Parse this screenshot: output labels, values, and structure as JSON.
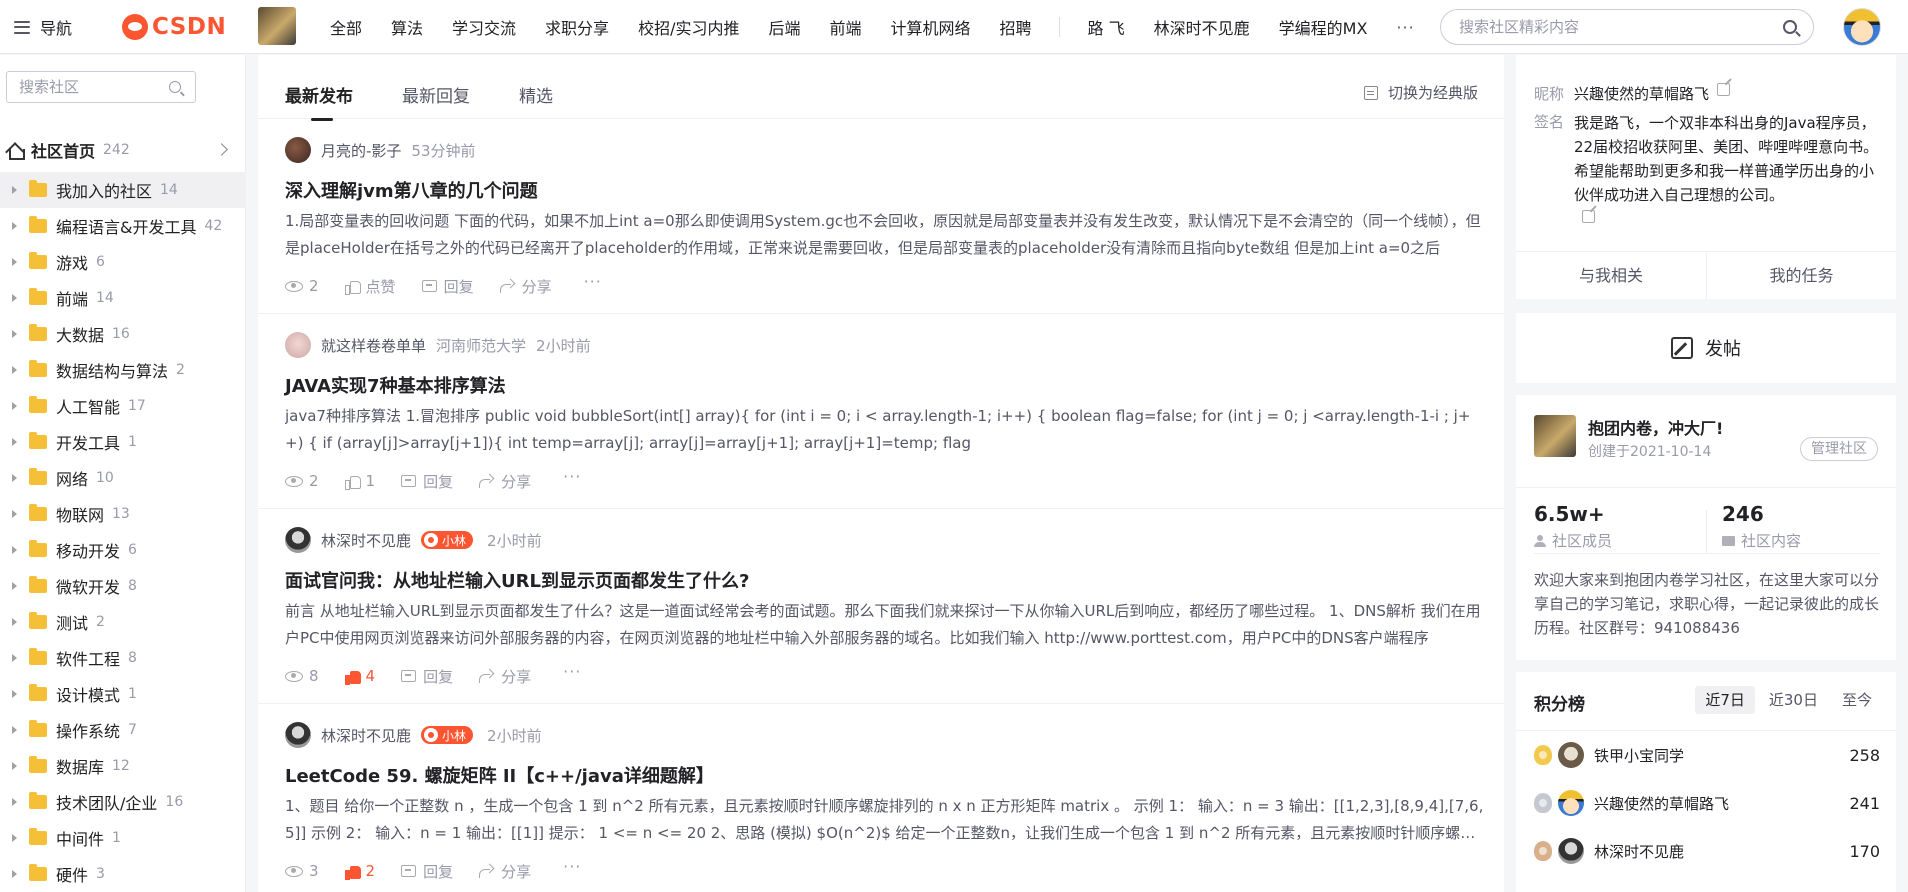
{
  "header": {
    "nav_label": "导航",
    "logo_text": "CSDN",
    "nav_items": [
      "全部",
      "算法",
      "学习交流",
      "求职分享",
      "校招/实习内推",
      "后端",
      "前端",
      "计算机网络",
      "招聘"
    ],
    "extra_items": [
      "路 飞",
      "林深时不见鹿",
      "学编程的MX"
    ],
    "more": "···",
    "search_placeholder": "搜索社区精彩内容",
    "colors": {
      "brand": "#fc5531"
    }
  },
  "sidebar": {
    "search_placeholder": "搜索社区",
    "home": {
      "label": "社区首页",
      "count": "242"
    },
    "categories": [
      {
        "label": "我加入的社区",
        "count": "14"
      },
      {
        "label": "编程语言&开发工具",
        "count": "42"
      },
      {
        "label": "游戏",
        "count": "6"
      },
      {
        "label": "前端",
        "count": "14"
      },
      {
        "label": "大数据",
        "count": "16"
      },
      {
        "label": "数据结构与算法",
        "count": "2"
      },
      {
        "label": "人工智能",
        "count": "17"
      },
      {
        "label": "开发工具",
        "count": "1"
      },
      {
        "label": "网络",
        "count": "10"
      },
      {
        "label": "物联网",
        "count": "13"
      },
      {
        "label": "移动开发",
        "count": "6"
      },
      {
        "label": "微软开发",
        "count": "8"
      },
      {
        "label": "测试",
        "count": "2"
      },
      {
        "label": "软件工程",
        "count": "8"
      },
      {
        "label": "设计模式",
        "count": "1"
      },
      {
        "label": "操作系统",
        "count": "7"
      },
      {
        "label": "数据库",
        "count": "12"
      },
      {
        "label": "技术团队/企业",
        "count": "16"
      },
      {
        "label": "中间件",
        "count": "1"
      },
      {
        "label": "硬件",
        "count": "3"
      }
    ]
  },
  "feed": {
    "tabs": [
      "最新发布",
      "最新回复",
      "精选"
    ],
    "switch_label": "切换为经典版",
    "action_labels": {
      "like": "点赞",
      "reply": "回复",
      "share": "分享",
      "more": "···"
    },
    "posts": [
      {
        "author": "月亮的-影子",
        "school": "",
        "badge": "",
        "time": "53分钟前",
        "title": "深入理解jvm第八章的几个问题",
        "excerpt": "1.局部变量表的回收问题 下面的代码，如果不加上int a=0那么即使调用System.gc也不会回收，原因就是局部变量表并没有发生改变，默认情况下是不会清空的（同一个线帧），但是placeHolder在括号之外的代码已经离开了placeholder的作用域，正常来说是需要回收，但是局部变量表的placeholder没有清除而且指向byte数组 但是加上int a=0之后",
        "views": "2",
        "likes": "点赞",
        "liked": false
      },
      {
        "author": "就这样卷卷单单",
        "school": "河南师范大学",
        "badge": "",
        "time": "2小时前",
        "title": "JAVA实现7种基本排序算法",
        "excerpt": "java7种排序算法 1.冒泡排序 public void bubbleSort(int[] array){ for (int i = 0; i < array.length-1; i++) { boolean flag=false; for (int j = 0; j <array.length-1-i ; j++) { if (array[j]>array[j+1]){ int temp=array[j]; array[j]=array[j+1]; array[j+1]=temp; flag",
        "views": "2",
        "likes": "1",
        "liked": false
      },
      {
        "author": "林深时不见鹿",
        "school": "",
        "badge": "小林",
        "time": "2小时前",
        "title": "面试官问我：从地址栏输入URL到显示页面都发生了什么?",
        "excerpt": "前言 从地址栏输入URL到显示页面都发生了什么？这是一道面试经常会考的面试题。那么下面我们就来探讨一下从你输入URL后到响应，都经历了哪些过程。 1、DNS解析 我们在用户PC中使用网页浏览器来访问外部服务器的内容，在网页浏览器的地址栏中输入外部服务器的域名。比如我们输入 http://www.porttest.com，用户PC中的DNS客户端程序",
        "views": "8",
        "likes": "4",
        "liked": true
      },
      {
        "author": "林深时不见鹿",
        "school": "",
        "badge": "小林",
        "time": "2小时前",
        "title": "LeetCode 59. 螺旋矩阵 II【c++/java详细题解】",
        "excerpt": "1、题目 给你一个正整数 n ，生成一个包含 1 到 n^2 所有元素，且元素按顺时针顺序螺旋排列的 n x n 正方形矩阵 matrix 。 示例 1： 输入：n = 3 输出：[[1,2,3],[8,9,4],[7,6,5]] 示例 2： 输入：n = 1 输出：[[1]] 提示： 1 <= n <= 20 2、思路 (模拟) $O(n^2)$ 给定一个正整数n，让我们生成一个包含 1 到 n^2 所有元素，且元素按顺时针顺序螺旋排列",
        "views": "3",
        "likes": "2",
        "liked": true
      }
    ]
  },
  "profile": {
    "nick_label": "昵称",
    "nick": "兴趣使然的草帽路飞",
    "sign_label": "签名",
    "bio": "我是路飞，一个双非本科出身的Java程序员，22届校招收获阿里、美团、哔哩哔哩意向书。希望能帮助到更多和我一样普通学历出身的小伙伴成功进入自己理想的公司。",
    "tabs": [
      "与我相关",
      "我的任务"
    ]
  },
  "post_button": {
    "label": "发帖"
  },
  "community": {
    "name": "抱团内卷，冲大厂!",
    "created": "创建于2021-10-14",
    "manage_label": "管理社区",
    "members": {
      "value": "6.5w+",
      "label": "社区成员"
    },
    "contents": {
      "value": "246",
      "label": "社区内容"
    },
    "description": "欢迎大家来到抱团内卷学习社区，在这里大家可以分享自己的学习笔记，求职心得，一起记录彼此的成长历程。社区群号：941088436"
  },
  "ranking": {
    "title": "积分榜",
    "tabs": [
      "近7日",
      "近30日",
      "至今"
    ],
    "rows": [
      {
        "name": "铁甲小宝同学",
        "score": "258"
      },
      {
        "name": "兴趣使然的草帽路飞",
        "score": "241"
      },
      {
        "name": "林深时不见鹿",
        "score": "170"
      }
    ]
  }
}
